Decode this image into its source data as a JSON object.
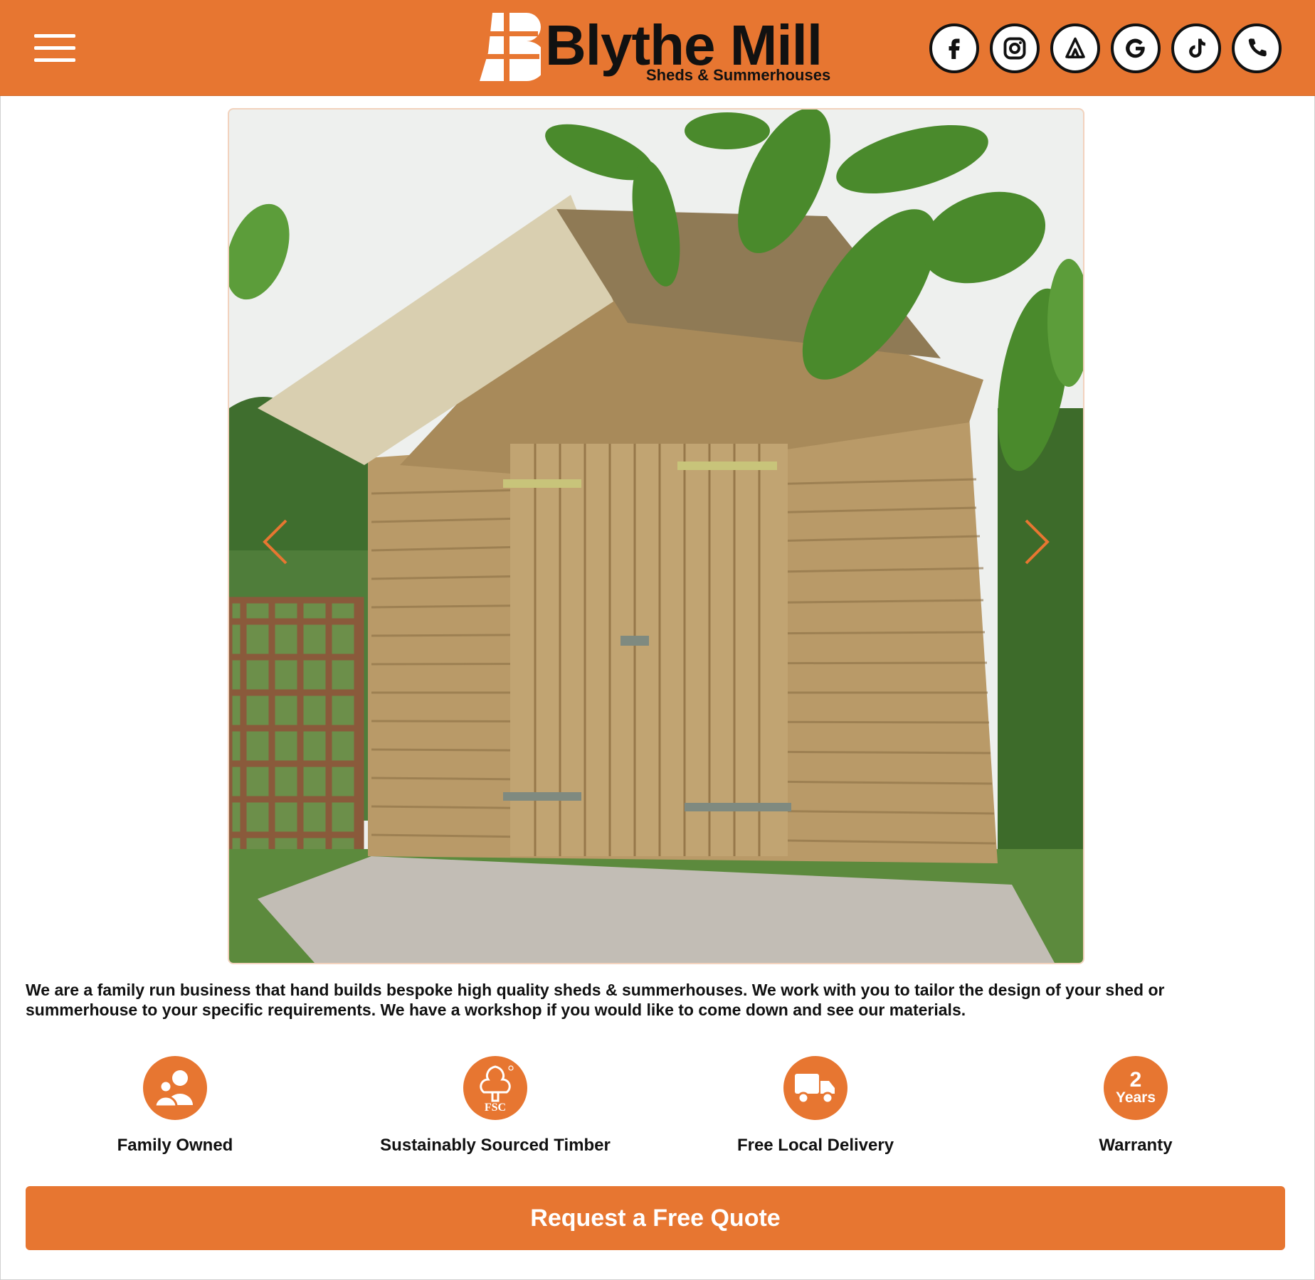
{
  "brand": {
    "name": "Blythe Mill",
    "tagline": "Sheds & Summerhouses",
    "accent_color": "#e77631"
  },
  "header": {
    "menu_icon": "hamburger-menu-icon",
    "socials": [
      {
        "name": "facebook",
        "icon": "facebook-icon"
      },
      {
        "name": "instagram",
        "icon": "instagram-icon"
      },
      {
        "name": "houzz",
        "icon": "houzz-icon"
      },
      {
        "name": "google",
        "icon": "google-icon"
      },
      {
        "name": "tiktok",
        "icon": "tiktok-icon"
      },
      {
        "name": "phone",
        "icon": "phone-icon"
      }
    ]
  },
  "slider": {
    "prev_icon": "chevron-left-icon",
    "next_icon": "chevron-right-icon"
  },
  "intro": {
    "text": "We are a family run business that hand builds bespoke high quality sheds & summerhouses. We work with you to tailor the design of your shed or summerhouse to your specific requirements. We have a workshop if you would like to come down and see our materials."
  },
  "features": [
    {
      "label": "Family Owned",
      "icon": "family-icon"
    },
    {
      "label": "Sustainably Sourced Timber",
      "icon": "fsc-tree-icon",
      "badge_text": "FSC"
    },
    {
      "label": "Free Local Delivery",
      "icon": "delivery-truck-icon"
    },
    {
      "label": "Warranty",
      "icon": "warranty-badge-icon",
      "badge_number": "2",
      "badge_text": "Years"
    }
  ],
  "cta": {
    "label": "Request a Free Quote"
  }
}
